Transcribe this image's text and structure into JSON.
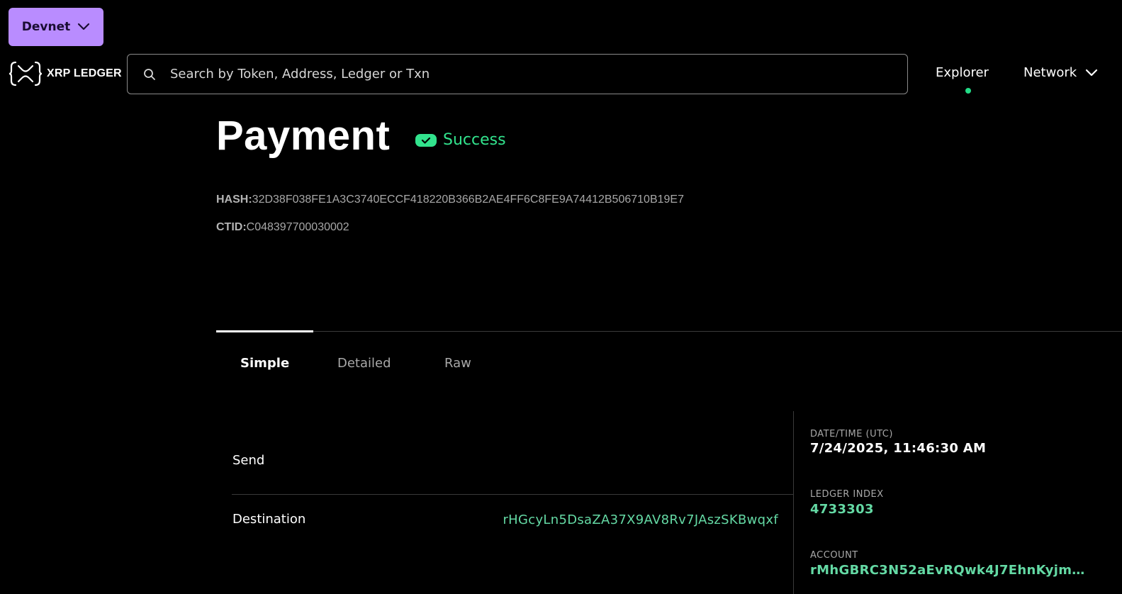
{
  "network_selector": {
    "label": "Devnet"
  },
  "brand": {
    "name": "XRP LEDGER"
  },
  "search": {
    "placeholder": "Search by Token, Address, Ledger or Txn"
  },
  "nav": {
    "explorer": "Explorer",
    "network": "Network"
  },
  "transaction": {
    "type": "Payment",
    "status": "Success",
    "hash_label": "HASH:",
    "hash": "32D38F038FE1A3C3740ECCF418220B366B2AE4FF6C8FE9A74412B506710B19E7",
    "ctid_label": "CTID:",
    "ctid": "C048397700030002"
  },
  "tabs": [
    {
      "label": "Simple",
      "active": true
    },
    {
      "label": "Detailed",
      "active": false
    },
    {
      "label": "Raw",
      "active": false
    }
  ],
  "simple": {
    "send_label": "Send",
    "destination_label": "Destination",
    "destination_value": "rHGcyLn5DsaZA37X9AV8Rv7JAszSKBwqxf"
  },
  "sidebar": {
    "datetime_label": "DATE/TIME (UTC)",
    "datetime_value": "7/24/2025, 11:46:30 AM",
    "ledger_index_label": "LEDGER INDEX",
    "ledger_index_value": "4733303",
    "account_label": "ACCOUNT",
    "account_value": "rMhGBRC3N52aEvRQwk4J7EhnKyjmM..."
  },
  "colors": {
    "accent_purple": "#b98cff",
    "success_green": "#32e38d",
    "link_green": "#64d9a4"
  }
}
